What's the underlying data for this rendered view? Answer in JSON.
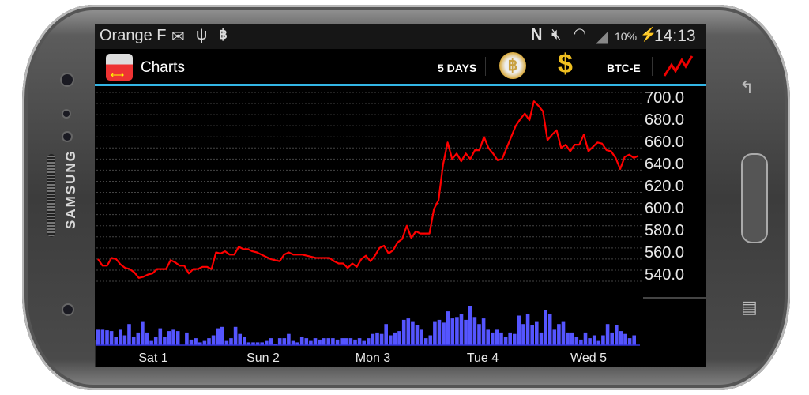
{
  "device": {
    "brand": "SAMSUNG"
  },
  "status_bar": {
    "carrier": "Orange F",
    "battery": "10%",
    "time": "14:13",
    "icons": [
      "mail-icon",
      "usb-icon",
      "bitcoin-icon",
      "nfc-icon",
      "mute-icon",
      "wifi-icon",
      "signal-icon",
      "battery-charging-icon"
    ]
  },
  "action_bar": {
    "title": "Charts",
    "period_label": "5 DAYS",
    "exchange_label": "BTC-E",
    "icons": [
      "app-logo-icon",
      "bitcoin-coin-icon",
      "dollar-icon",
      "chart-line-icon"
    ]
  },
  "colors": {
    "price_line": "#ff0000",
    "volume_bars": "#5555ff",
    "accent": "#33b5e5"
  },
  "chart_data": {
    "type": "line",
    "title": "",
    "xlabel": "",
    "ylabel": "",
    "ylim": [
      530,
      710
    ],
    "y_ticks": [
      "700.0",
      "680.0",
      "660.0",
      "640.0",
      "620.0",
      "600.0",
      "580.0",
      "560.0",
      "540.0"
    ],
    "x_ticks": [
      "Sat 1",
      "Sun 2",
      "Mon 3",
      "Tue 4",
      "Wed 5"
    ],
    "series": [
      {
        "name": "price",
        "values": [
          555,
          549,
          549,
          556,
          555,
          550,
          547,
          546,
          543,
          538,
          539,
          541,
          542,
          546,
          546,
          546,
          554,
          552,
          549,
          549,
          542,
          546,
          546,
          548,
          548,
          546,
          561,
          560,
          562,
          559,
          559,
          566,
          564,
          564,
          562,
          561,
          559,
          557,
          555,
          554,
          553,
          559,
          561,
          559,
          559,
          559,
          558,
          557,
          556,
          556,
          556,
          556,
          553,
          551,
          551,
          547,
          551,
          548,
          555,
          558,
          553,
          558,
          565,
          567,
          560,
          563,
          570,
          573,
          585,
          574,
          580,
          578,
          578,
          578,
          600,
          608,
          640,
          660,
          645,
          650,
          643,
          650,
          645,
          653,
          653,
          665,
          655,
          650,
          644,
          645,
          655,
          665,
          675,
          681,
          686,
          680,
          697,
          693,
          688,
          662,
          667,
          671,
          655,
          658,
          652,
          658,
          658,
          667,
          652,
          656,
          660,
          659,
          653,
          652,
          646,
          636,
          647,
          649,
          646,
          648
        ]
      },
      {
        "name": "volume",
        "values": [
          55,
          55,
          53,
          50,
          30,
          55,
          35,
          75,
          30,
          45,
          85,
          45,
          15,
          30,
          60,
          30,
          50,
          55,
          50,
          0,
          45,
          20,
          25,
          10,
          15,
          25,
          35,
          60,
          65,
          15,
          25,
          65,
          40,
          30,
          10,
          10,
          10,
          10,
          15,
          25,
          5,
          25,
          25,
          40,
          15,
          10,
          30,
          25,
          15,
          25,
          20,
          25,
          25,
          25,
          20,
          25,
          25,
          25,
          20,
          25,
          15,
          25,
          40,
          45,
          40,
          75,
          35,
          45,
          50,
          90,
          95,
          85,
          70,
          55,
          25,
          35,
          85,
          90,
          80,
          120,
          95,
          100,
          110,
          90,
          140,
          100,
          75,
          95,
          55,
          45,
          55,
          45,
          30,
          45,
          40,
          105,
          75,
          110,
          70,
          85,
          45,
          125,
          110,
          55,
          75,
          85,
          45,
          45,
          30,
          20,
          45,
          25,
          35,
          15,
          35,
          75,
          45,
          70,
          50,
          40,
          25,
          35
        ]
      }
    ]
  }
}
